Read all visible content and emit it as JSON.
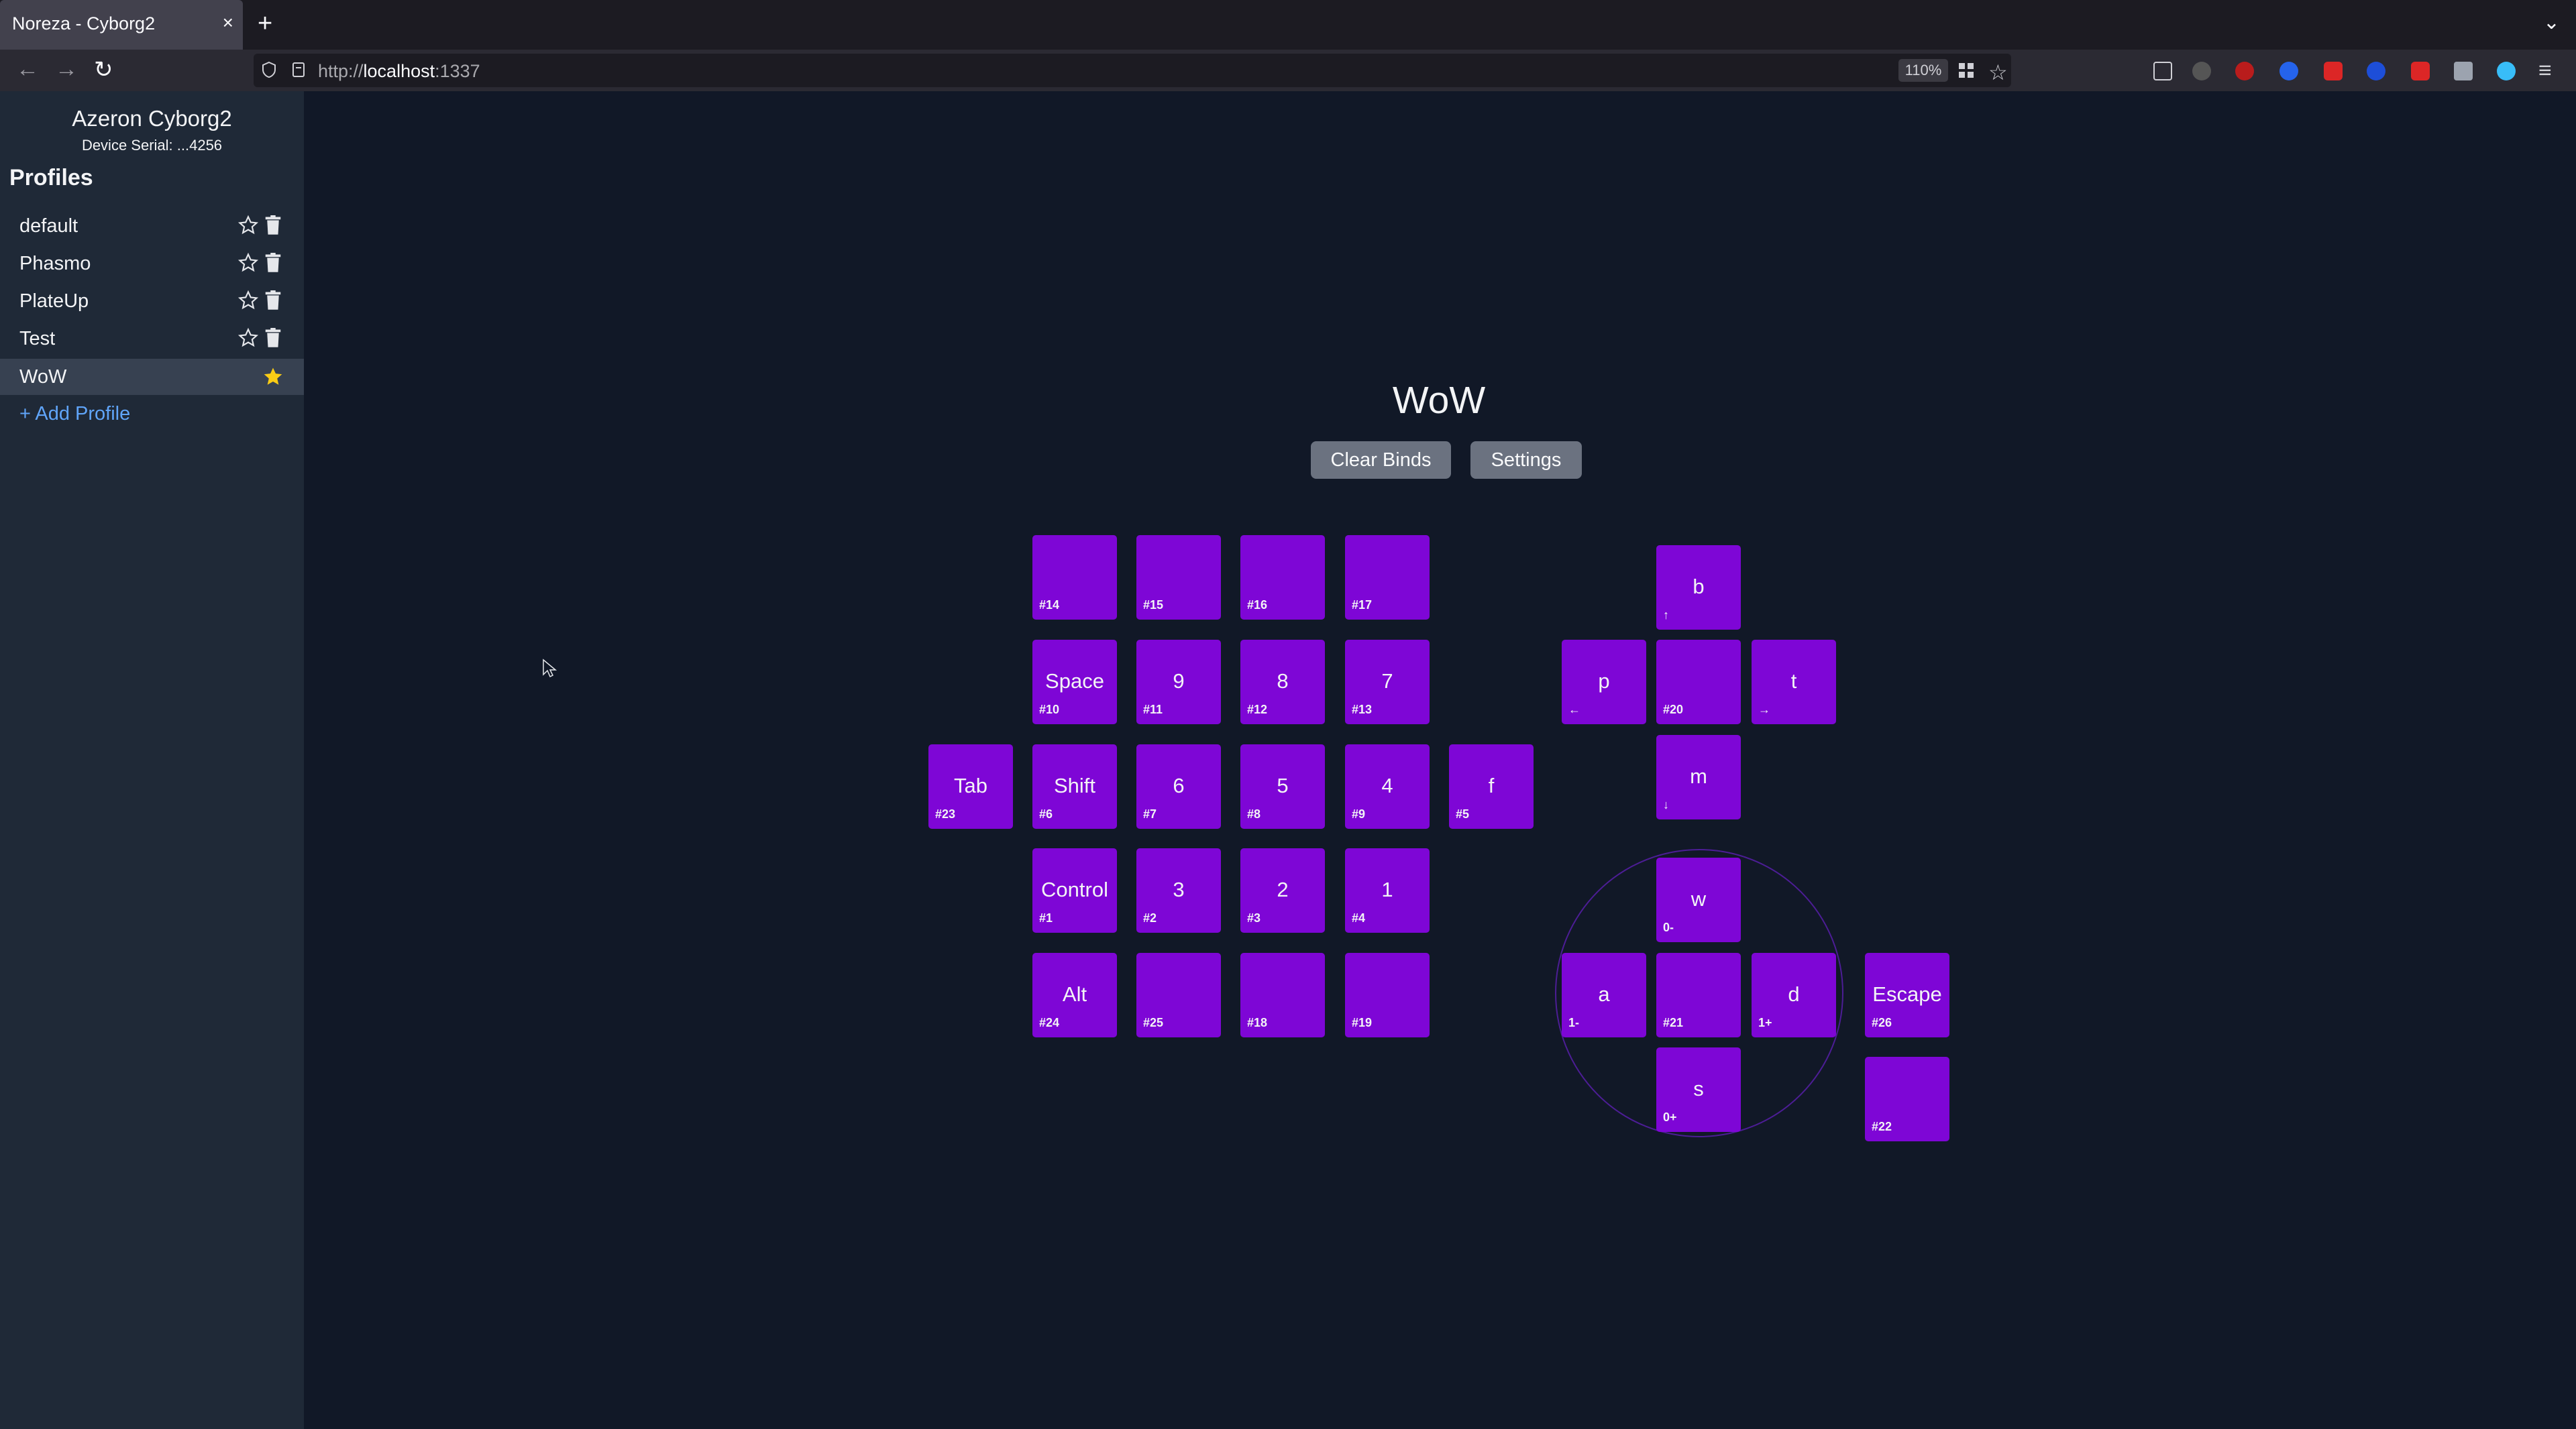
{
  "browser": {
    "tab_title": "Noreza - Cyborg2",
    "tab_close": "×",
    "new_tab": "+",
    "url_scheme": "http://",
    "url_host": "localhost",
    "url_port": ":1337",
    "zoom": "110%"
  },
  "sidebar": {
    "device_name": "Azeron Cyborg2",
    "device_serial": "Device Serial: ...4256",
    "profiles_heading": "Profiles",
    "profiles": [
      {
        "name": "default",
        "active": false
      },
      {
        "name": "Phasmo",
        "active": false
      },
      {
        "name": "PlateUp",
        "active": false
      },
      {
        "name": "Test",
        "active": false
      },
      {
        "name": "WoW",
        "active": true
      }
    ],
    "add_profile": "+ Add Profile"
  },
  "main": {
    "profile_title": "WoW",
    "clear_binds": "Clear Binds",
    "settings": "Settings"
  },
  "keys": {
    "k14": {
      "label": "",
      "id": "#14"
    },
    "k15": {
      "label": "",
      "id": "#15"
    },
    "k16": {
      "label": "",
      "id": "#16"
    },
    "k17": {
      "label": "",
      "id": "#17"
    },
    "k10": {
      "label": "Space",
      "id": "#10"
    },
    "k11": {
      "label": "9",
      "id": "#11"
    },
    "k12": {
      "label": "8",
      "id": "#12"
    },
    "k13": {
      "label": "7",
      "id": "#13"
    },
    "k23": {
      "label": "Tab",
      "id": "#23"
    },
    "k6": {
      "label": "Shift",
      "id": "#6"
    },
    "k7": {
      "label": "6",
      "id": "#7"
    },
    "k8": {
      "label": "5",
      "id": "#8"
    },
    "k9": {
      "label": "4",
      "id": "#9"
    },
    "k5": {
      "label": "f",
      "id": "#5"
    },
    "k1": {
      "label": "Control",
      "id": "#1"
    },
    "k2": {
      "label": "3",
      "id": "#2"
    },
    "k3": {
      "label": "2",
      "id": "#3"
    },
    "k4": {
      "label": "1",
      "id": "#4"
    },
    "k24": {
      "label": "Alt",
      "id": "#24"
    },
    "k25": {
      "label": "",
      "id": "#25"
    },
    "k18": {
      "label": "",
      "id": "#18"
    },
    "k19": {
      "label": "",
      "id": "#19"
    },
    "dpad_up": {
      "label": "b",
      "id": "↑"
    },
    "dpad_left": {
      "label": "p",
      "id": "←"
    },
    "k20": {
      "label": "",
      "id": "#20"
    },
    "dpad_right": {
      "label": "t",
      "id": "→"
    },
    "dpad_down": {
      "label": "m",
      "id": "↓"
    },
    "stick_up": {
      "label": "w",
      "id": "0-"
    },
    "stick_left": {
      "label": "a",
      "id": "1-"
    },
    "k21": {
      "label": "",
      "id": "#21"
    },
    "stick_right": {
      "label": "d",
      "id": "1+"
    },
    "stick_down": {
      "label": "s",
      "id": "0+"
    },
    "k26": {
      "label": "Escape",
      "id": "#26"
    },
    "k22": {
      "label": "",
      "id": "#22"
    }
  },
  "colors": {
    "key_purple": "#7e06d6",
    "sidebar_bg": "#1f2937",
    "page_bg": "#111827",
    "accent_link": "#60a5fa",
    "favorite_star": "#facc15"
  }
}
